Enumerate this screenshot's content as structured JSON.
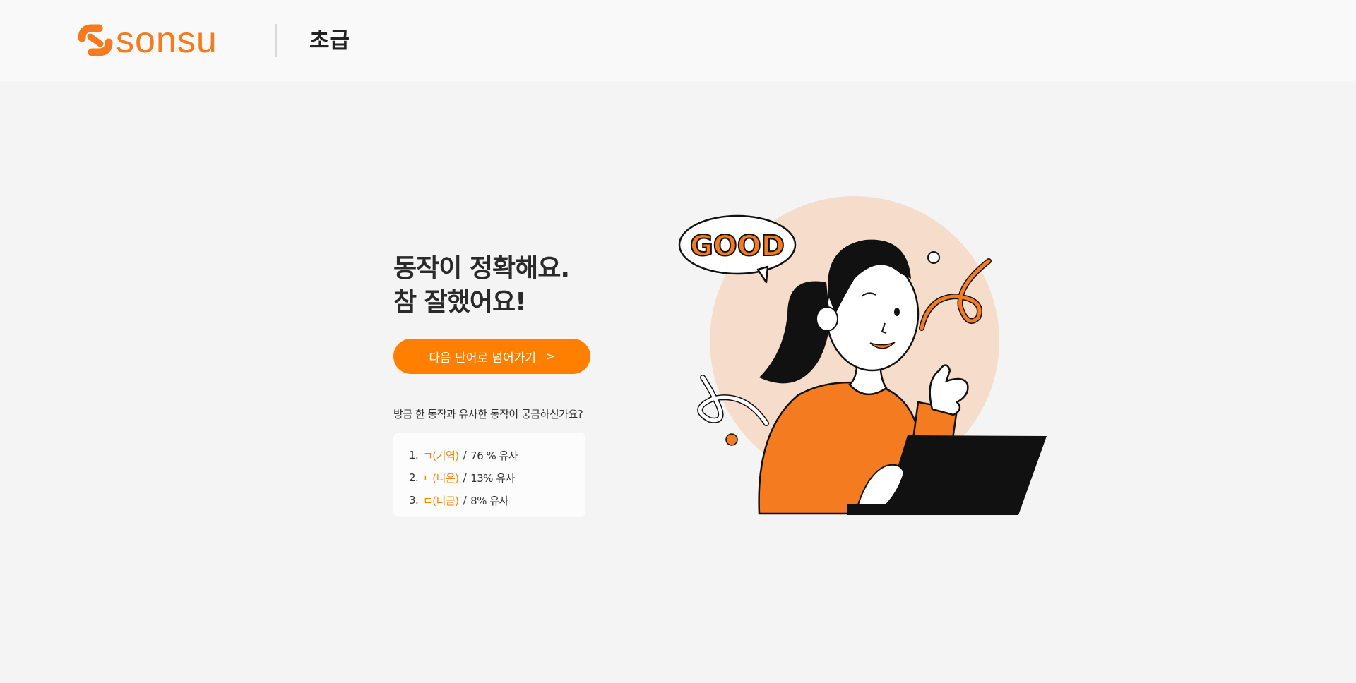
{
  "header": {
    "logo_text": "sonsu",
    "level": "초급"
  },
  "result": {
    "title_line1": "동작이 정확해요.",
    "title_line2": "참 잘했어요!"
  },
  "next_button": {
    "label": "다음 단어로 넘어가기",
    "chevron": ">"
  },
  "similar": {
    "question": "방금 한 동작과 유사한 동작이 궁금하신가요?",
    "items": [
      {
        "num": "1.",
        "word": "ㄱ(기역)",
        "sep": "/",
        "similarity": "76 % 유사"
      },
      {
        "num": "2.",
        "word": "ㄴ(니은)",
        "sep": "/",
        "similarity": "13% 유사"
      },
      {
        "num": "3.",
        "word": "ㄷ(디귿)",
        "sep": "/",
        "similarity": "8% 유사"
      }
    ]
  },
  "illustration": {
    "bubble_text": "GOOD"
  },
  "colors": {
    "accent": "#ff7f00",
    "brand": "#f47b20",
    "background": "#f4f4f4",
    "header_bg": "#f9f9f9"
  },
  "icons": [
    "sonsu-logo-icon",
    "chevron-right-icon"
  ]
}
